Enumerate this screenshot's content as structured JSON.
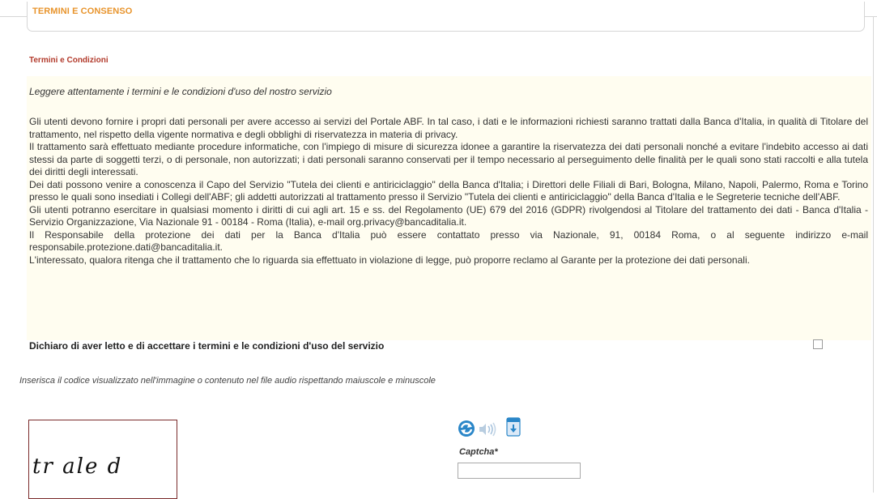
{
  "section": {
    "title": "TERMINI E CONSENSO",
    "subtitle": "Termini e Condizioni"
  },
  "terms": {
    "intro": "Leggere attentamente i termini e le condizioni d'uso del nostro servizio",
    "paragraphs": [
      "Gli utenti devono fornire i propri dati personali per avere accesso ai servizi del Portale ABF. In tal caso, i dati e le informazioni richiesti saranno trattati dalla Banca d'Italia, in qualità di Titolare del trattamento, nel rispetto della vigente normativa e degli obblighi di riservatezza in materia di privacy.",
      "Il trattamento sarà effettuato mediante procedure informatiche, con l'impiego di misure di sicurezza idonee a garantire la riservatezza dei dati personali nonché a evitare l'indebito accesso ai dati stessi da parte di soggetti terzi, o di personale, non autorizzati; i dati personali saranno conservati per il tempo necessario al perseguimento delle finalità per le quali sono stati raccolti e alla tutela dei diritti degli interessati.",
      "Dei dati possono venire a conoscenza il Capo del Servizio \"Tutela dei clienti e antiriciclaggio\" della Banca d'Italia; i Direttori delle Filiali di Bari, Bologna, Milano, Napoli, Palermo, Roma e Torino presso le quali sono insediati i Collegi dell'ABF; gli addetti autorizzati al trattamento presso il Servizio \"Tutela dei clienti e antiriciclaggio\" della Banca d'Italia e le Segreterie tecniche dell'ABF.",
      "Gli utenti potranno esercitare in qualsiasi momento i diritti di cui agli art. 15 e ss. del Regolamento (UE) 679 del 2016 (GDPR) rivolgendosi al Titolare del trattamento dei dati - Banca d'Italia - Servizio Organizzazione, Via Nazionale 91 - 00184 - Roma (Italia), e-mail org.privacy@bancaditalia.it.",
      "Il Responsabile della protezione dei dati per la Banca d'Italia può essere contattato presso via Nazionale, 91, 00184 Roma, o al seguente indirizzo e-mail responsabile.protezione.dati@bancaditalia.it.",
      "L'interessato, qualora ritenga che il trattamento che lo riguarda sia effettuato in violazione di legge, può proporre reclamo al Garante per la protezione dei dati personali."
    ]
  },
  "consent": {
    "label": "Dichiaro di aver letto e di accettare i termini e le condizioni d'uso del servizio",
    "checked": false
  },
  "captcha": {
    "hint": "Inserisca il codice visualizzato nell'immagine o contenuto nel file audio rispettando maiuscole e minuscole",
    "image_text": "tr ale d",
    "label": "Captcha*",
    "value": "",
    "icons": [
      "refresh-icon",
      "audio-icon",
      "download-icon"
    ]
  },
  "colors": {
    "section_title": "#e8942c",
    "subtitle": "#b23a2b",
    "terms_background": "#fffdf0",
    "border": "#d6d6d6"
  }
}
